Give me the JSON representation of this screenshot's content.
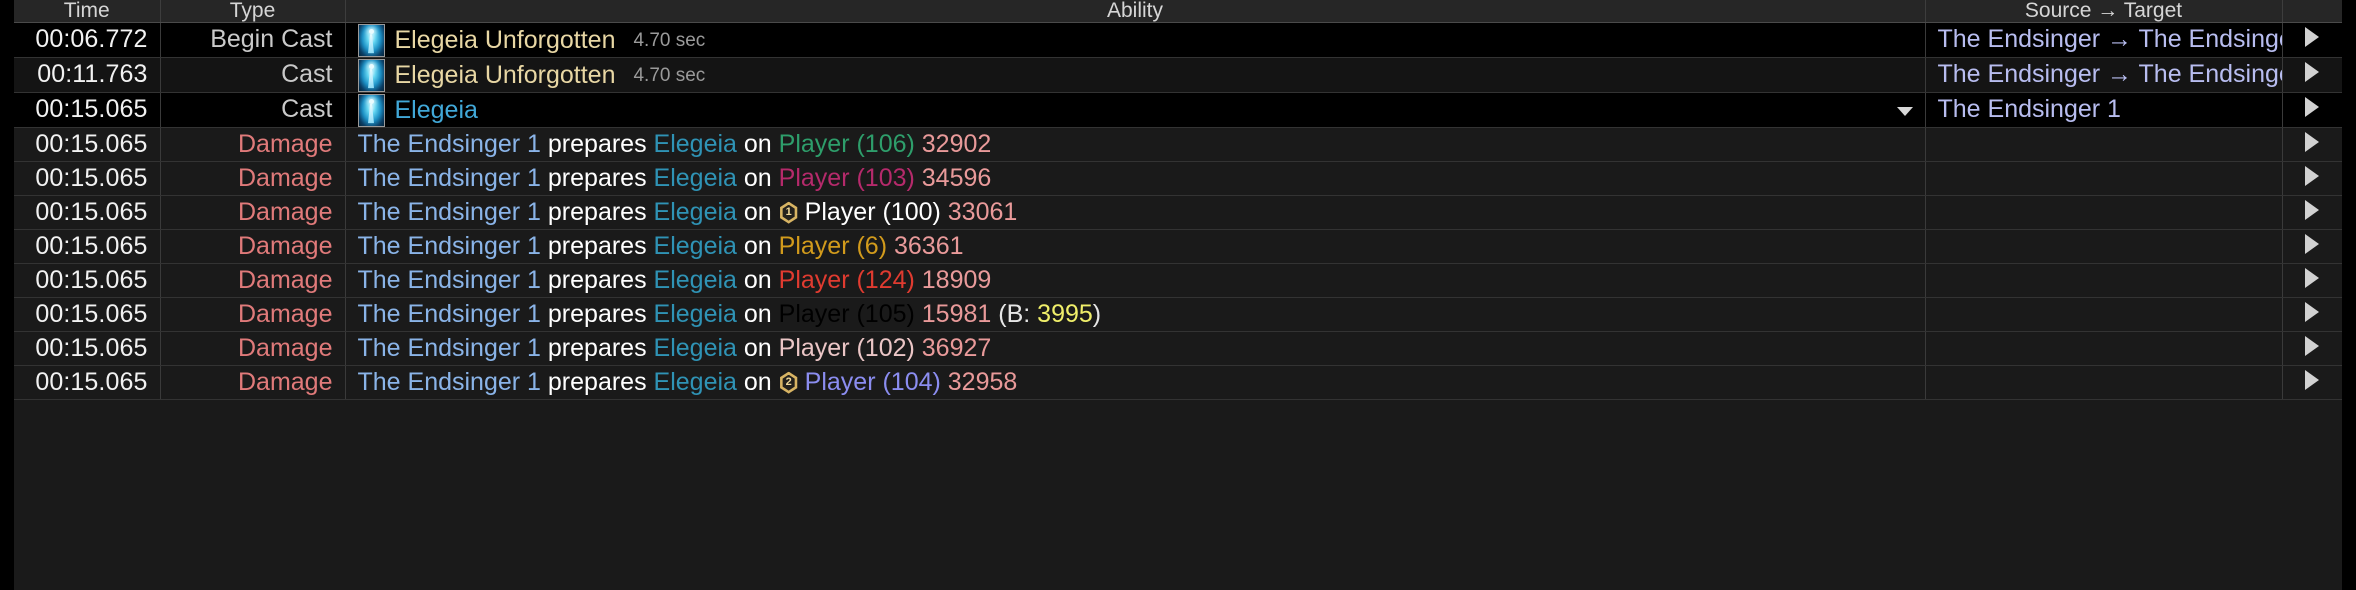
{
  "window": {
    "theme_bg": "#000000",
    "table_bg": "#1a1a1a"
  },
  "columns": [
    {
      "key": "time",
      "label": "Time"
    },
    {
      "key": "type",
      "label": "Type"
    },
    {
      "key": "ability",
      "label": "Ability"
    },
    {
      "key": "srctgt",
      "label": "Source → Target"
    },
    {
      "key": "expand",
      "label": ""
    }
  ],
  "colors": {
    "damage_type": "#e07a7a",
    "cast_type": "#c9c9c9",
    "ability_name": "#e8d7a4",
    "ability_name_selected": "#41a8d8",
    "source_name": "#8ab4e8",
    "ability_inline": "#2f93b5",
    "amount": "#e99a9a",
    "block_value": "#f0ef6a",
    "srctgt": "#b8bdf0",
    "target_green": "#2e9e6b",
    "target_magenta": "#b52a6b",
    "target_white": "#ffffff",
    "target_gold": "#d29b1c",
    "target_red": "#e03b30",
    "target_pale": "#ebc6c6",
    "target_lightblue": "#b9cfe8",
    "target_lilac": "#8b8df0"
  },
  "icons": {
    "ability": "elegeia-ability-icon",
    "dropdown": "chevron-down-icon",
    "expander": "expand-row-icon",
    "job_badge": "job-role-badge-icon"
  },
  "rows": [
    {
      "kind": "cast",
      "shade": "dark",
      "time": "00:06.772",
      "type": "Begin Cast",
      "ability_name": "Elegeia Unforgotten",
      "duration": "4.70 sec",
      "has_caret": false,
      "srctgt": "The Endsinger → The Endsinger"
    },
    {
      "kind": "cast",
      "shade": "even",
      "time": "00:11.763",
      "type": "Cast",
      "ability_name": "Elegeia Unforgotten",
      "duration": "4.70 sec",
      "has_caret": false,
      "srctgt": "The Endsinger → The Endsinger"
    },
    {
      "kind": "cast-selected",
      "shade": "dark",
      "time": "00:15.065",
      "type": "Cast",
      "ability_name": "Elegeia",
      "duration": "",
      "has_caret": true,
      "srctgt": "The Endsinger 1"
    },
    {
      "kind": "damage",
      "shade": "odd",
      "time": "00:15.065",
      "type": "Damage",
      "source": "The Endsinger 1",
      "verb": "prepares",
      "ability_inline": "Elegeia",
      "on": "on",
      "badge": "",
      "target": "Player (106)",
      "target_color": "green",
      "amount": "32902",
      "block_label": "",
      "block_value": "",
      "srctgt": ""
    },
    {
      "kind": "damage",
      "shade": "odd",
      "time": "00:15.065",
      "type": "Damage",
      "source": "The Endsinger 1",
      "verb": "prepares",
      "ability_inline": "Elegeia",
      "on": "on",
      "badge": "",
      "target": "Player (103)",
      "target_color": "magenta",
      "amount": "34596",
      "block_label": "",
      "block_value": "",
      "srctgt": ""
    },
    {
      "kind": "damage",
      "shade": "odd",
      "time": "00:15.065",
      "type": "Damage",
      "source": "The Endsinger 1",
      "verb": "prepares",
      "ability_inline": "Elegeia",
      "on": "on",
      "badge": "1",
      "target": "Player (100)",
      "target_color": "white",
      "amount": "33061",
      "block_label": "",
      "block_value": "",
      "srctgt": ""
    },
    {
      "kind": "damage",
      "shade": "odd",
      "time": "00:15.065",
      "type": "Damage",
      "source": "The Endsinger 1",
      "verb": "prepares",
      "ability_inline": "Elegeia",
      "on": "on",
      "badge": "",
      "target": "Player (6)",
      "target_color": "gold",
      "amount": "36361",
      "block_label": "",
      "block_value": "",
      "srctgt": ""
    },
    {
      "kind": "damage",
      "shade": "odd",
      "time": "00:15.065",
      "type": "Damage",
      "source": "The Endsinger 1",
      "verb": "prepares",
      "ability_inline": "Elegeia",
      "on": "on",
      "badge": "",
      "target": "Player (124)",
      "target_color": "red",
      "amount": "18909",
      "block_label": "",
      "block_value": "",
      "srctgt": ""
    },
    {
      "kind": "damage",
      "shade": "odd",
      "time": "00:15.065",
      "type": "Damage",
      "source": "The Endsinger 1",
      "verb": "prepares",
      "ability_inline": "Elegeia",
      "on": "on",
      "badge": "",
      "target": "Player (105)",
      "target_color": "lightblue",
      "amount": "15981",
      "block_label": "(B:",
      "block_value": "3995",
      "srctgt": ""
    },
    {
      "kind": "damage",
      "shade": "odd",
      "time": "00:15.065",
      "type": "Damage",
      "source": "The Endsinger 1",
      "verb": "prepares",
      "ability_inline": "Elegeia",
      "on": "on",
      "badge": "",
      "target": "Player (102)",
      "target_color": "pale",
      "amount": "36927",
      "block_label": "",
      "block_value": "",
      "srctgt": ""
    },
    {
      "kind": "damage",
      "shade": "odd",
      "time": "00:15.065",
      "type": "Damage",
      "source": "The Endsinger 1",
      "verb": "prepares",
      "ability_inline": "Elegeia",
      "on": "on",
      "badge": "2",
      "target": "Player (104)",
      "target_color": "lilac",
      "amount": "32958",
      "block_label": "",
      "block_value": "",
      "srctgt": ""
    }
  ]
}
